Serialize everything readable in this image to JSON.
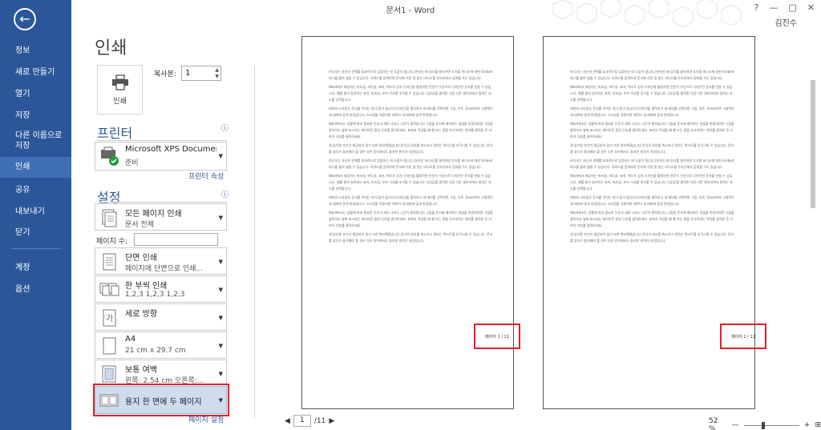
{
  "window": {
    "title": "문서1 - Word",
    "user": "김진수",
    "controls": [
      "?",
      "—",
      "□",
      "✕"
    ]
  },
  "nav": {
    "back_icon": "arrow-left-icon",
    "items": [
      {
        "label": "정보"
      },
      {
        "label": "새로 만들기"
      },
      {
        "label": "열기"
      },
      {
        "label": "저장"
      },
      {
        "label": "다른 이름으로 저장"
      },
      {
        "label": "인쇄",
        "active": true
      },
      {
        "label": "공유"
      },
      {
        "label": "내보내기"
      },
      {
        "label": "닫기"
      },
      {
        "label": "계정"
      },
      {
        "label": "옵션"
      }
    ]
  },
  "print": {
    "title": "인쇄",
    "print_button": "인쇄",
    "copies_label": "복사본:",
    "copies_value": "1"
  },
  "printer": {
    "section_title": "프린터",
    "name": "Microsoft XPS Document...",
    "status": "준비",
    "properties_link": "프린터 속성"
  },
  "settings": {
    "section_title": "설정",
    "pages_label": "페이지 수:",
    "pages_value": "",
    "options": [
      {
        "line1": "모든 페이지 인쇄",
        "line2": "문서 전체"
      },
      {
        "line1": "단면 인쇄",
        "line2": "페이지에 단면으로 인쇄..."
      },
      {
        "line1": "한 부씩 인쇄",
        "line2": "1,2,3    1,2,3    1,2,3"
      },
      {
        "line1": "세로 방향",
        "line2": ""
      },
      {
        "line1": "A4",
        "line2": "21 cm x 29.7 cm"
      },
      {
        "line1": "보통 여백",
        "line2": "왼쪽:   2.54 cm    오른쪽:..."
      },
      {
        "line1": "용지 한 면에 두 페이지",
        "line2": ""
      }
    ],
    "page_setup_link": "페이지 설정"
  },
  "preview": {
    "paragraphs": [
      "비디오는 자신의 견해를 효과적으로 입증하는 데 도움이 됩니다.[온라인 비디오]를 클릭하면 추가할 비디오에 대한 Embed 태그를 붙여 넣을 수 있습니다. 키워드를 입력하여 문서에 가장 잘 맞는 비디오를 온라인에서 검색할 수도 있습니다.",
      "Word에서 제공하는 머리글, 바닥글, 표지, 텍스트 상자 디자인을 활용하면 전문가 수준으로 디자인된 문서를 만들 수 있습니다. 예를 들어 일치하는 표지, 머리글, 보조 기사를 추가할 수 있습니다. [삽입]을 클릭한 다음 다른 갤러리에서 원하는 요소를 선택합니다.",
      "테마와 스타일도 문서를 꾸미는 데 도움이 됩니다.[디자인]을 클릭하고 새 테마를 선택하면 그림, 차트, SmartArt 그래픽이 새 테마에 맞게 변경됩니다. 스타일을 적용하면 제목이 새 테마에 맞게 변경됩니다.",
      "Word에서는 상황에 따라 필요한 단추가 새로 나타나 시간이 절약됩니다.그림을 문서에 배치하는 방법을 변경하려면 그림을 클릭하고 옆에 표시되는 레이아웃 옵션 단추를 클릭하세요. 표에서 작업할 때 행 또는 열을 추가하려는 위치를 클릭한 후 더하기 기호를 클릭하세요.",
      "새 읽기용 보기가 제공되어 읽기 또한 편리해졌습니다.문서의 일부를 축소하고 원하는 텍스트를 부각시킬 수 있습니다. 문서를 읽다가 중지해야 할 경우 다른 장치에서도 중지한 위치가 저장됩니다."
    ],
    "page_labels": [
      "페이지 1 / 11",
      "페이지 2 / 11"
    ],
    "current_page": "1",
    "total_pages": "/11",
    "zoom": "52 %"
  }
}
